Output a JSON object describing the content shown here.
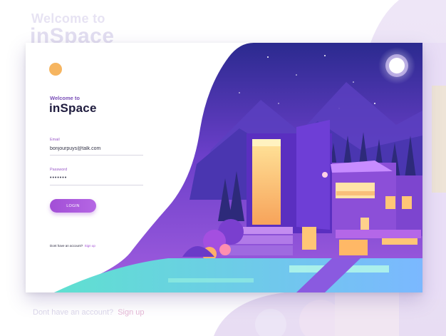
{
  "background": {
    "welcome": "Welcome to",
    "brand": "inSpace",
    "footer_text": "Dont have an account?",
    "footer_link": "Sign up"
  },
  "login": {
    "welcome": "Welcome to",
    "brand": "inSpace",
    "email_label": "Email",
    "email_value": "bonjourpuys@talk.com",
    "password_label": "Password",
    "password_value": "•••••••",
    "login_button": "LOGIN",
    "signup_text": "Dont have an account?",
    "signup_link": "Sign up"
  },
  "colors": {
    "accent": "#a24fd6",
    "brand_text": "#1f1c3e",
    "sun_dot": "#f6b560"
  },
  "icons": [
    "sun-dot-icon"
  ]
}
